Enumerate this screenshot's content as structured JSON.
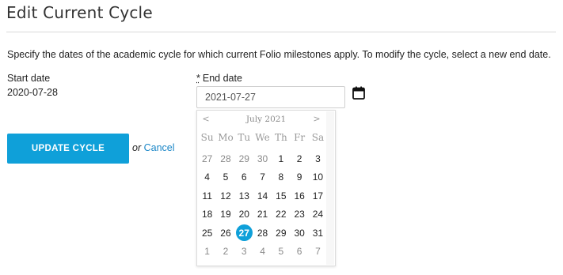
{
  "page": {
    "title": "Edit Current Cycle",
    "description": "Specify the dates of the academic cycle for which current Folio milestones apply. To modify the cycle, select a new end date."
  },
  "form": {
    "start_label": "Start date",
    "start_value": "2020-07-28",
    "end_required_mark": "*",
    "end_label": "End date",
    "end_value": "2021-07-27",
    "update_label": "UPDATE CYCLE",
    "or_text": "or",
    "cancel_label": "Cancel"
  },
  "calendar": {
    "prev": "<",
    "next": ">",
    "month_label": "July 2021",
    "weekdays": [
      "Su",
      "Mo",
      "Tu",
      "We",
      "Th",
      "Fr",
      "Sa"
    ],
    "selected_day": "27",
    "weeks": [
      [
        {
          "d": "27",
          "m": true
        },
        {
          "d": "28",
          "m": true
        },
        {
          "d": "29",
          "m": true
        },
        {
          "d": "30",
          "m": true
        },
        {
          "d": "1"
        },
        {
          "d": "2"
        },
        {
          "d": "3"
        }
      ],
      [
        {
          "d": "4"
        },
        {
          "d": "5"
        },
        {
          "d": "6"
        },
        {
          "d": "7"
        },
        {
          "d": "8"
        },
        {
          "d": "9"
        },
        {
          "d": "10"
        }
      ],
      [
        {
          "d": "11"
        },
        {
          "d": "12"
        },
        {
          "d": "13"
        },
        {
          "d": "14"
        },
        {
          "d": "15"
        },
        {
          "d": "16"
        },
        {
          "d": "17"
        }
      ],
      [
        {
          "d": "18"
        },
        {
          "d": "19"
        },
        {
          "d": "20"
        },
        {
          "d": "21"
        },
        {
          "d": "22"
        },
        {
          "d": "23"
        },
        {
          "d": "24"
        }
      ],
      [
        {
          "d": "25"
        },
        {
          "d": "26"
        },
        {
          "d": "27",
          "s": true
        },
        {
          "d": "28"
        },
        {
          "d": "29"
        },
        {
          "d": "30"
        },
        {
          "d": "31"
        }
      ],
      [
        {
          "d": "1",
          "m": true
        },
        {
          "d": "2",
          "m": true
        },
        {
          "d": "3",
          "m": true
        },
        {
          "d": "4",
          "m": true
        },
        {
          "d": "5",
          "m": true
        },
        {
          "d": "6",
          "m": true
        },
        {
          "d": "7",
          "m": true
        }
      ]
    ]
  },
  "colors": {
    "accent": "#0fa0d9",
    "link": "#1a86c7"
  },
  "icons": {
    "calendar": "calendar-icon"
  }
}
